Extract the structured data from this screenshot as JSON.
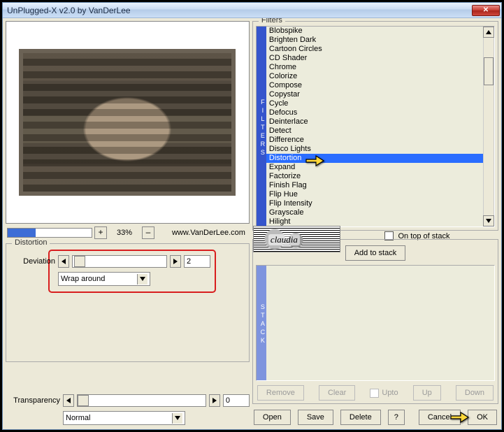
{
  "window": {
    "title": "UnPlugged-X v2.0 by VanDerLee"
  },
  "zoom": {
    "percent_label": "33%",
    "plus": "+",
    "minus": "–",
    "link": "www.VanDerLee.com"
  },
  "distortion_group": {
    "legend": "Distortion",
    "deviation_label": "Deviation",
    "deviation_value": "2",
    "wrap_label": "Wrap around"
  },
  "transparency": {
    "label": "Transparency",
    "value": "0",
    "mode": "Normal"
  },
  "filters": {
    "legend": "Filters",
    "rail": "FILTERS",
    "items": [
      "Blobspike",
      "Brighten Dark",
      "Cartoon Circles",
      "CD Shader",
      "Chrome",
      "Colorize",
      "Compose",
      "Copystar",
      "Cycle",
      "Defocus",
      "Deinterlace",
      "Detect",
      "Difference",
      "Disco Lights",
      "Distortion",
      "Expand",
      "Factorize",
      "Finish Flag",
      "Flip Hue",
      "Flip Intensity",
      "Grayscale",
      "Hilight"
    ],
    "selected_index": 14,
    "on_top_label": "On top of stack",
    "decor_text": "claudia"
  },
  "stack": {
    "rail": "STACK",
    "add_label": "Add to stack",
    "remove": "Remove",
    "clear": "Clear",
    "upto": "Upto",
    "up": "Up",
    "down": "Down"
  },
  "buttons": {
    "open": "Open",
    "save": "Save",
    "delete": "Delete",
    "help": "?",
    "cancel": "Cancel",
    "ok": "OK"
  }
}
